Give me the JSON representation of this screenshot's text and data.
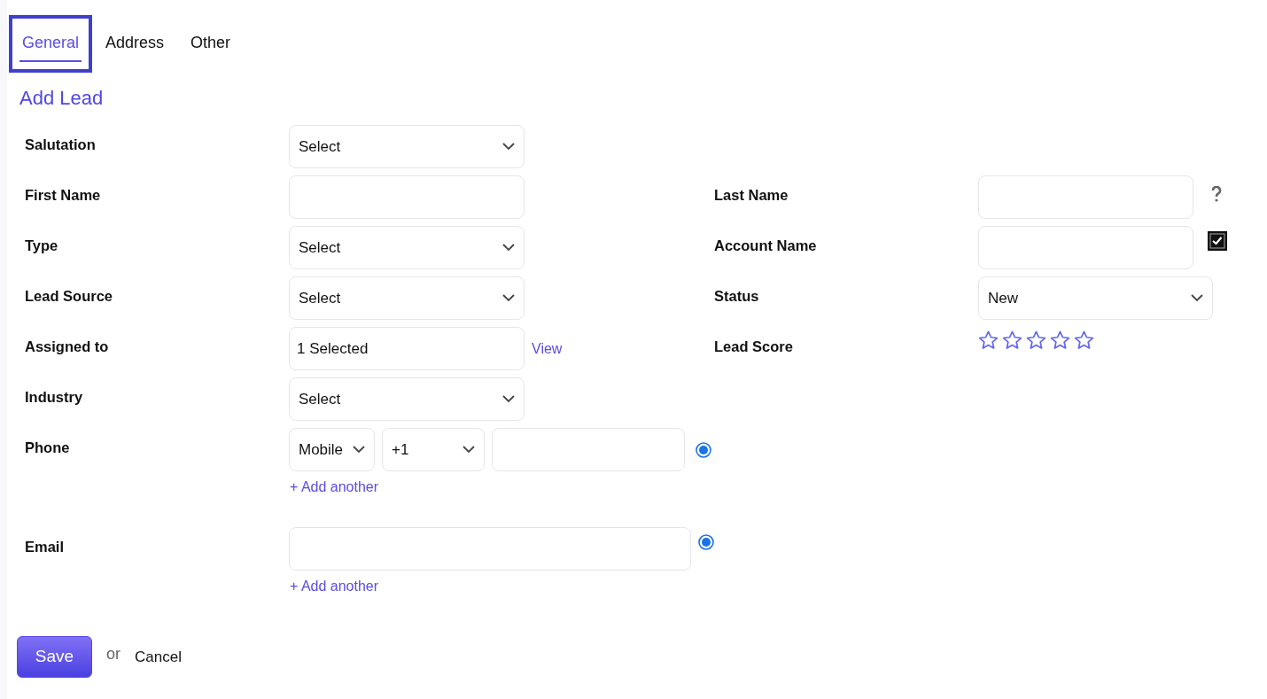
{
  "tabs": [
    {
      "label": "General",
      "selected": true
    },
    {
      "label": "Address",
      "selected": false
    },
    {
      "label": "Other",
      "selected": false
    }
  ],
  "title": "Add Lead",
  "rows": [
    {
      "left": {
        "label": "Salutation",
        "kind": "select",
        "value": "Select"
      }
    },
    {
      "left": {
        "label": "First Name",
        "kind": "text"
      },
      "right": {
        "label": "Last Name",
        "kind": "text",
        "help": true
      }
    },
    {
      "left": {
        "label": "Type",
        "kind": "select",
        "value": "Select"
      },
      "right": {
        "label": "Account Name",
        "kind": "text",
        "checkbox": {
          "checked": true
        }
      }
    },
    {
      "left": {
        "label": "Lead Source",
        "kind": "select",
        "value": "Select"
      },
      "right": {
        "label": "Status",
        "kind": "select",
        "value": "New"
      }
    },
    {
      "left": {
        "label": "Assigned to",
        "kind": "multi",
        "value": "1 Selected",
        "link": "View"
      },
      "right": {
        "label": "Lead Score",
        "kind": "stars",
        "stars": 0
      }
    },
    {
      "left": {
        "label": "Industry",
        "kind": "select",
        "value": "Select"
      }
    },
    {
      "left": {
        "label": "Phone",
        "kind": "phone",
        "type": "Mobile",
        "code": "+1",
        "primary": {
          "selected": true
        },
        "add": "+ Add another"
      }
    },
    {
      "left": {
        "label": "Email",
        "kind": "email",
        "primary": {
          "selected": true
        },
        "add": "+ Add another"
      }
    }
  ],
  "actions": {
    "save": "Save",
    "or": "or",
    "cancel": "Cancel"
  }
}
